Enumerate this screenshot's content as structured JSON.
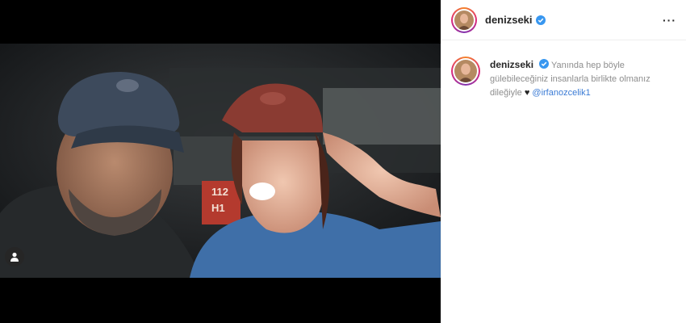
{
  "post": {
    "username": "denizseki",
    "more_icon": "···",
    "caption_text": "Yanında hep böyle gülebileceğiniz insanlarla birlikte olmanız dileğiyle",
    "caption_heart": "♥",
    "mention": "@irfanozcelik1"
  },
  "photo": {
    "sign_top": "112",
    "sign_bottom": "H1"
  },
  "colors": {
    "verified": "#3897f0",
    "mention": "#3a7bd5",
    "shirt": "#3f6fa8",
    "cap_red": "#8a3b32"
  }
}
